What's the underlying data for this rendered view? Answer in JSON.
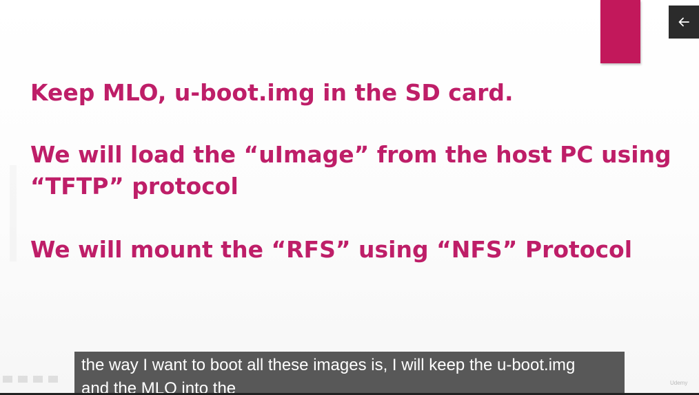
{
  "slide": {
    "lines": [
      "Keep MLO, u-boot.img in the SD card.",
      "We will load the “uImage” from the host PC using",
      "“TFTP” protocol",
      "We will mount the “RFS” using “NFS” Protocol"
    ],
    "text_color": "#be1e68",
    "accent_color": "#c2185b"
  },
  "player": {
    "back_button_icon": "arrow-left-icon",
    "caption": "the way I want to boot all these images is, I will keep the u-boot.img and the MLO into the",
    "brand": "Udemy"
  }
}
